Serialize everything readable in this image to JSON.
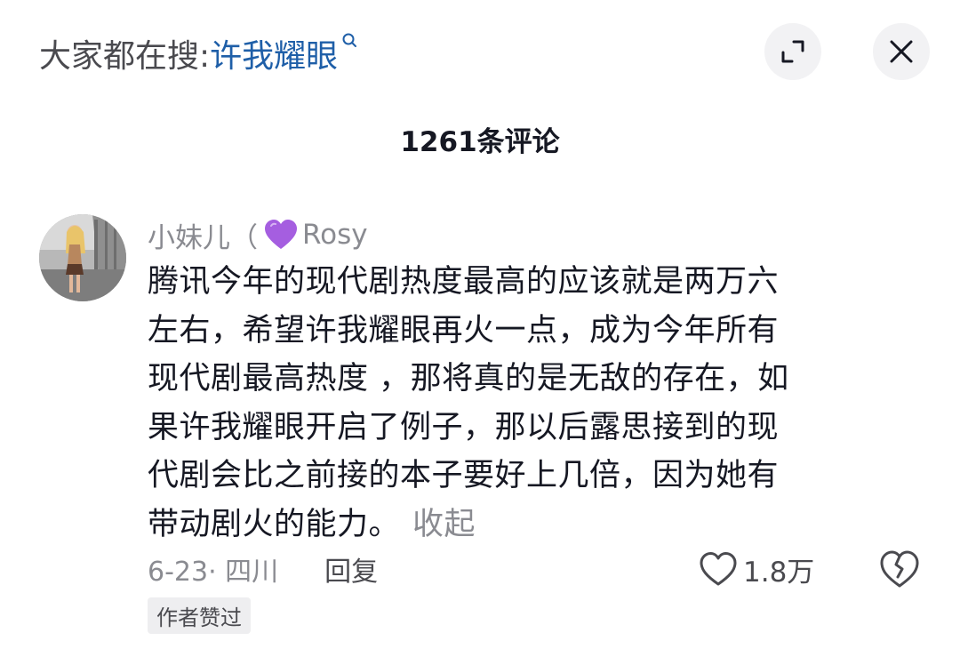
{
  "search": {
    "prefix": "大家都在搜:",
    "term": "许我耀眼"
  },
  "header": {
    "comment_count": "1261条评论",
    "expand_icon": "expand-icon",
    "close_icon": "close-icon"
  },
  "comment": {
    "username_prefix": "小妹儿（",
    "username_emoji": "purple-heart",
    "username_suffix": "Rosy",
    "lines": [
      "腾讯今年的现代剧热度最高的应该就是两万六",
      "左右，希望许我耀眼再火一点，成为今年所有",
      "现代剧最高热度 ，那将真的是无敌的存在，如",
      "果许我耀眼开启了例子，那以后露思接到的现",
      "代剧会比之前接的本子要好上几倍，因为她有",
      "带动剧火的能力。"
    ],
    "collapse_label": "收起",
    "date_location": "6-23· 四川",
    "reply_label": "回复",
    "like_count": "1.8万",
    "author_liked_badge": "作者赞过"
  },
  "colors": {
    "link_blue": "#1f5fa8",
    "muted_gray": "#8a8b91",
    "purple_heart": "#a55ee0"
  }
}
